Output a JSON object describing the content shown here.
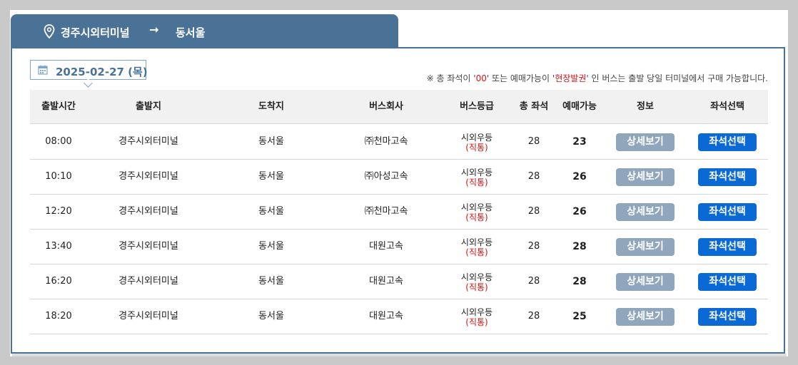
{
  "route": {
    "origin": "경주시외터미널",
    "arrow": "→",
    "destination": "동서울"
  },
  "date_label": "2025-02-27 (목)",
  "notice": {
    "prefix": "※ 총 좌석이 '",
    "red1": "00",
    "middle": "' 또는 예매가능이 '",
    "red2": "현장발권",
    "suffix": "' 인 버스는 출발 당일 터미널에서 구매 가능합니다."
  },
  "columns": [
    "출발시간",
    "출발지",
    "도착지",
    "버스회사",
    "버스등급",
    "총 좌석",
    "예매가능",
    "정보",
    "좌석선택"
  ],
  "rows": [
    {
      "time": "08:00",
      "from": "경주시외터미널",
      "to": "동서울",
      "company": "㈜천마고속",
      "grade": "시외우등",
      "grade_sub": "(직통)",
      "total": "28",
      "available": "23",
      "detail_label": "상세보기",
      "select_label": "좌석선택"
    },
    {
      "time": "10:10",
      "from": "경주시외터미널",
      "to": "동서울",
      "company": "㈜아성고속",
      "grade": "시외우등",
      "grade_sub": "(직통)",
      "total": "28",
      "available": "26",
      "detail_label": "상세보기",
      "select_label": "좌석선택"
    },
    {
      "time": "12:20",
      "from": "경주시외터미널",
      "to": "동서울",
      "company": "㈜천마고속",
      "grade": "시외우등",
      "grade_sub": "(직통)",
      "total": "28",
      "available": "26",
      "detail_label": "상세보기",
      "select_label": "좌석선택"
    },
    {
      "time": "13:40",
      "from": "경주시외터미널",
      "to": "동서울",
      "company": "대원고속",
      "grade": "시외우등",
      "grade_sub": "(직통)",
      "total": "28",
      "available": "28",
      "detail_label": "상세보기",
      "select_label": "좌석선택"
    },
    {
      "time": "16:20",
      "from": "경주시외터미널",
      "to": "동서울",
      "company": "대원고속",
      "grade": "시외우등",
      "grade_sub": "(직통)",
      "total": "28",
      "available": "28",
      "detail_label": "상세보기",
      "select_label": "좌석선택"
    },
    {
      "time": "18:20",
      "from": "경주시외터미널",
      "to": "동서울",
      "company": "대원고속",
      "grade": "시외우등",
      "grade_sub": "(직통)",
      "total": "28",
      "available": "25",
      "detail_label": "상세보기",
      "select_label": "좌석선택"
    }
  ],
  "icons": {
    "route_pin": "location-pin-icon",
    "date": "calendar-icon"
  },
  "colors": {
    "header_blue": "#4a7297",
    "detail_button": "#8fa6bd",
    "select_button": "#0a69d4",
    "notice_red": "#e01010"
  }
}
